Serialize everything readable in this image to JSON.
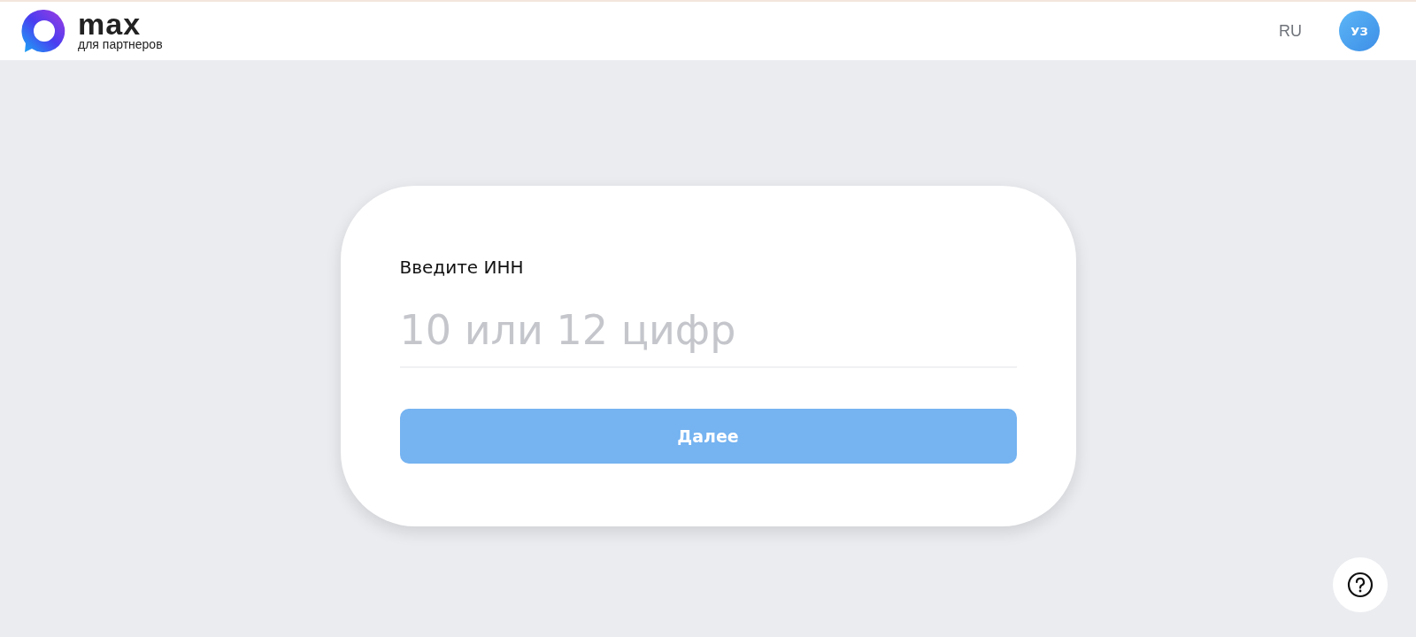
{
  "header": {
    "logo_word": "max",
    "logo_subtitle": "для партнеров",
    "language": "RU",
    "avatar_initials": "УЗ"
  },
  "form": {
    "label": "Введите ИНН",
    "input": {
      "placeholder": "10 или 12 цифр"
    },
    "button": {
      "label": "Далее",
      "disabled": true
    }
  }
}
